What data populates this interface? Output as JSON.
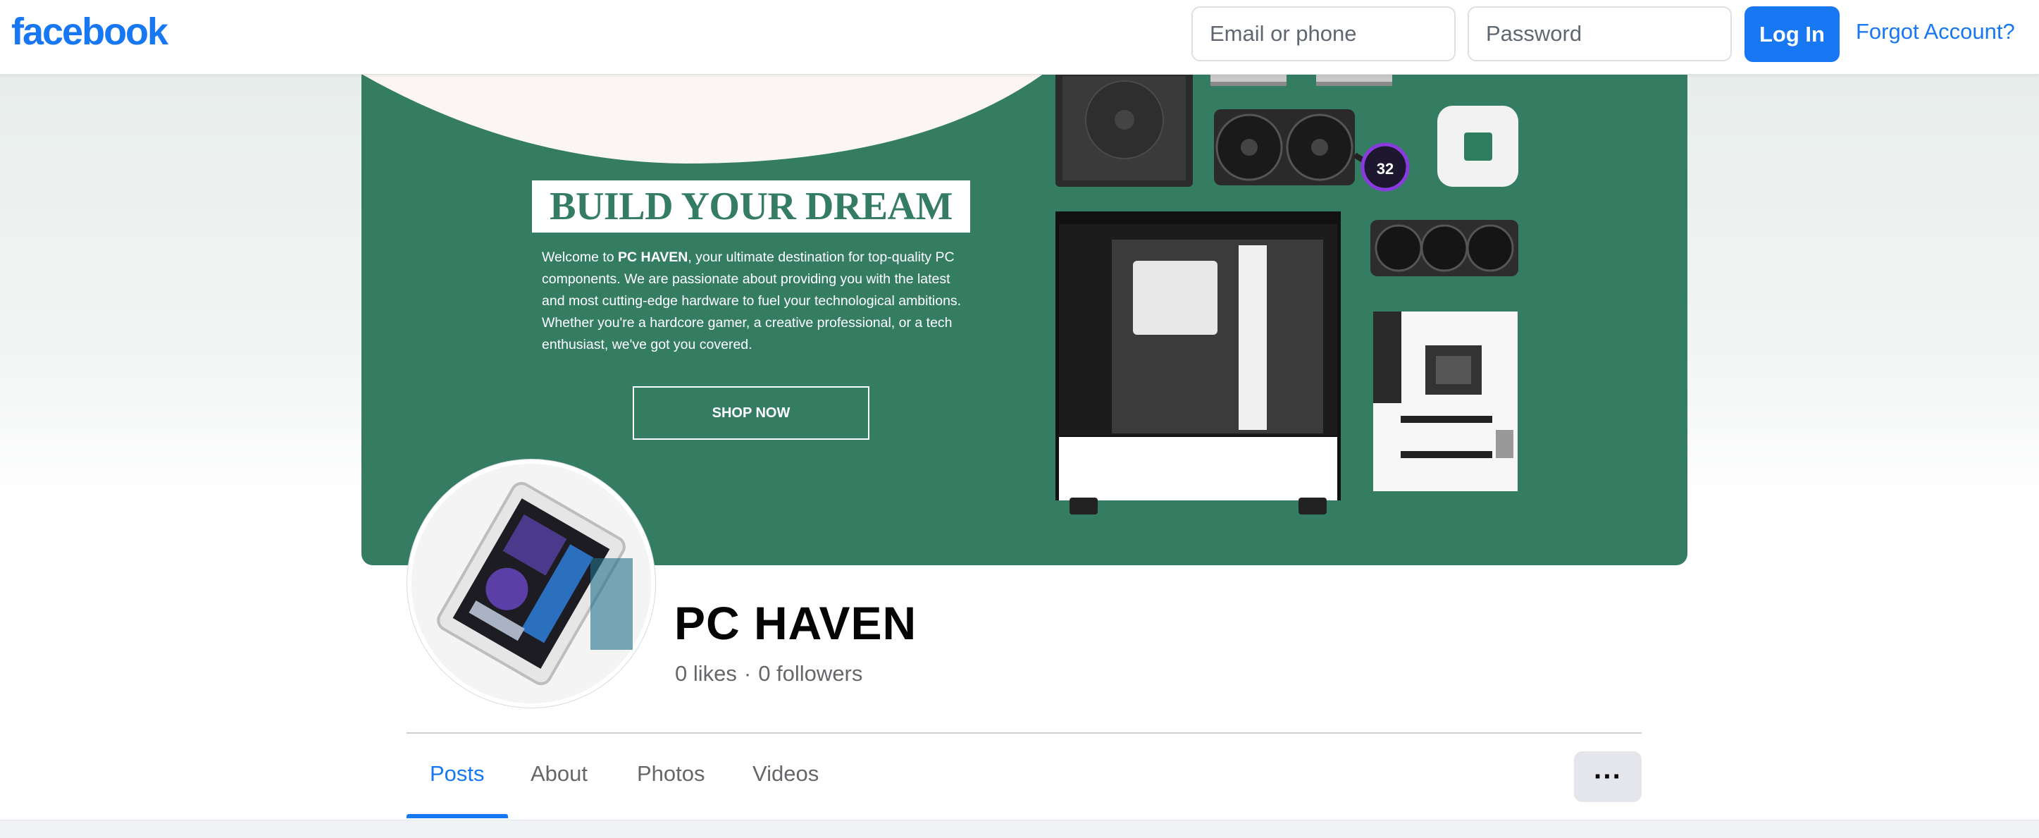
{
  "header": {
    "logo": "facebook",
    "email_placeholder": "Email or phone",
    "password_placeholder": "Password",
    "login_label": "Log In",
    "forgot_label": "Forgot Account?"
  },
  "cover": {
    "headline": "BUILD YOUR DREAM PC",
    "intro_before": "Welcome to ",
    "intro_brand": "PC HAVEN",
    "intro_after": ", your ultimate destination for top-quality PC components. We are passionate about providing you with the latest and most cutting-edge hardware to fuel your technological ambitions. Whether you're a hardcore gamer, a creative professional, or a tech enthusiast, we've got you covered.",
    "shop_button": "SHOP NOW",
    "cooler_display": "32"
  },
  "profile": {
    "name": "PC HAVEN",
    "likes": "0 likes",
    "separator": "·",
    "followers": "0 followers"
  },
  "tabs": [
    {
      "label": "Posts",
      "active": true
    },
    {
      "label": "About",
      "active": false
    },
    {
      "label": "Photos",
      "active": false
    },
    {
      "label": "Videos",
      "active": false
    }
  ],
  "more_button": "···",
  "colors": {
    "brand": "#1877f2",
    "cover_green": "#347d62",
    "text_secondary": "#65676b"
  },
  "icons": [
    "more-horizontal-icon"
  ]
}
